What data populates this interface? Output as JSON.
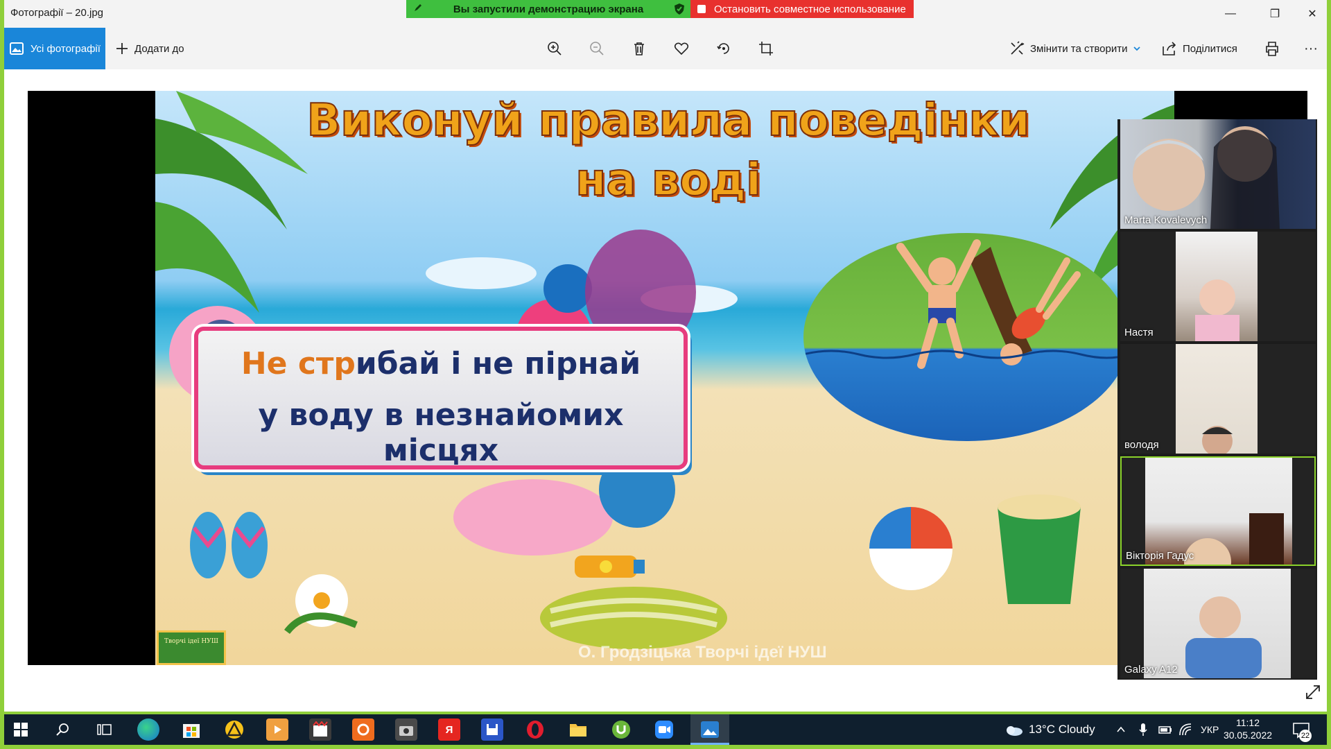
{
  "window": {
    "title": "Фотографії – 20.jpg",
    "minimize_glyph": "—",
    "restore_glyph": "❐",
    "close_glyph": "✕"
  },
  "share_banner": {
    "status": "Вы запустили демонстрацию экрана",
    "stop_label": "Остановить совместное использование"
  },
  "toolbar": {
    "all_photos": "Усі фотографії",
    "add_to": "Додати до",
    "edit_create": "Змінити та створити",
    "share": "Поділитися",
    "more": "···",
    "icons": [
      "zoom-in-icon",
      "zoom-out-icon",
      "delete-icon",
      "favorite-icon",
      "rotate-icon",
      "crop-icon",
      "print-icon"
    ]
  },
  "slide": {
    "title_line1": "Виконуй правила поведінки",
    "title_line2": "на воді",
    "sign_line1_part1": "Не стр",
    "sign_line1_part2": "ибай і  не пірнай",
    "sign_line2": "у воду в незнайомих місцях",
    "watermark": "О. Гродзіцька Творчі ідеї НУШ",
    "logo_text": "Творчі ідеї НУШ"
  },
  "participants": [
    {
      "name": "Marta Kovalevych",
      "active": false
    },
    {
      "name": "Настя",
      "active": false
    },
    {
      "name": "володя",
      "active": false
    },
    {
      "name": "Вікторія Гадус",
      "active": true
    },
    {
      "name": "Galaxy A12",
      "active": false
    }
  ],
  "taskbar": {
    "weather": "13°C  Cloudy",
    "language": "УКР",
    "time": "11:12",
    "date": "30.05.2022",
    "notifications": "22",
    "yandex_letter": "Я"
  },
  "colors": {
    "share_border": "#8fcf3a",
    "accent": "#1a86d9",
    "share_green": "#3fbf3f",
    "share_red": "#e8312e",
    "active_tile": "#8bd22b"
  }
}
